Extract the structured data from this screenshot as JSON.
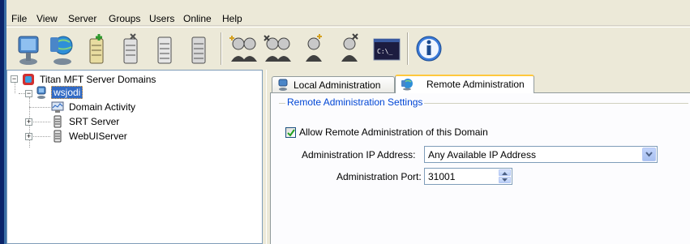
{
  "menu": [
    "File",
    "View",
    "Server",
    "Groups",
    "Users",
    "Online",
    "Help"
  ],
  "toolbar": [
    {
      "icon": "new-server-icon"
    },
    {
      "icon": "connect-server-icon"
    },
    {
      "icon": "new-domain-icon"
    },
    {
      "icon": "delete-domain-icon"
    },
    {
      "icon": "start-domain-icon"
    },
    {
      "icon": "stop-domain-icon"
    },
    {
      "icon": "new-group-icon"
    },
    {
      "icon": "delete-group-icon"
    },
    {
      "icon": "new-user-icon"
    },
    {
      "icon": "delete-user-icon"
    },
    {
      "icon": "command-prompt-icon"
    },
    {
      "icon": "info-icon"
    }
  ],
  "tree": {
    "root": "Titan MFT Server Domains",
    "server": "wsjodi",
    "children": [
      "Domain Activity",
      "SRT Server",
      "WebUIServer"
    ]
  },
  "tabs": [
    "Local Administration",
    "Remote Administration"
  ],
  "active_tab": "Remote Administration",
  "settings": {
    "group_title": "Remote Administration Settings",
    "allow_label": "Allow Remote Administration of this Domain",
    "allow_checked": true,
    "ip_label": "Administration IP Address:",
    "ip_value": "Any Available IP Address",
    "port_label": "Administration Port:",
    "port_value": "31001"
  },
  "colors": {
    "selection": "#316ac5",
    "group_title": "#0046d5",
    "active_tab_border": "#ffc83c"
  }
}
